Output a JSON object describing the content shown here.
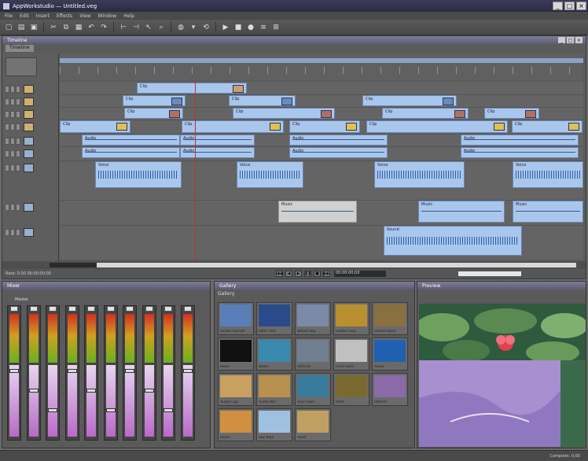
{
  "app": {
    "title": "AppWorkstudio — Untitled.veg",
    "window_controls": [
      "_",
      "□",
      "×"
    ]
  },
  "menu": [
    "File",
    "Edit",
    "Insert",
    "Effects",
    "View",
    "Window",
    "Help"
  ],
  "toolbar": {
    "icons": [
      "new-icon",
      "open-icon",
      "save-icon",
      "cut-icon",
      "copy-icon",
      "paste-icon",
      "undo-icon",
      "redo-icon",
      "trim-icon",
      "split-icon",
      "select-icon",
      "zoom-icon",
      "globe-icon",
      "marker-icon",
      "loop-icon",
      "play-icon",
      "stop-icon",
      "record-icon",
      "mixer-icon",
      "grid-icon"
    ]
  },
  "timeline": {
    "title": "Timeline",
    "tab": "Timeline",
    "tracks": [
      {
        "id": 1,
        "type": "video"
      },
      {
        "id": 2,
        "type": "video"
      },
      {
        "id": 3,
        "type": "video"
      },
      {
        "id": 4,
        "type": "video"
      },
      {
        "id": 5,
        "type": "audio"
      },
      {
        "id": 6,
        "type": "audio"
      },
      {
        "id": 7,
        "type": "audio"
      },
      {
        "id": 8,
        "type": "audio"
      },
      {
        "id": 9,
        "type": "audio"
      }
    ],
    "clips": [
      {
        "track": 0,
        "label": "Clip",
        "kind": "video"
      },
      {
        "track": 1,
        "label": "Clip",
        "kind": "video"
      },
      {
        "track": 2,
        "label": "Clip",
        "kind": "video"
      },
      {
        "track": 3,
        "label": "Clip",
        "kind": "video"
      },
      {
        "track": 4,
        "label": "Audio",
        "kind": "env"
      },
      {
        "track": 5,
        "label": "Audio",
        "kind": "env"
      },
      {
        "track": 6,
        "label": "Voice",
        "kind": "audio"
      },
      {
        "track": 7,
        "label": "Music",
        "kind": "env"
      },
      {
        "track": 8,
        "label": "Sound",
        "kind": "audio"
      }
    ],
    "status": "Rate: 0.00  00:00:00;00",
    "timecode": "00:00:00;00"
  },
  "mixer": {
    "title": "Mixer",
    "channels": 10,
    "master_label": "Master"
  },
  "gallery": {
    "title": "Gallery",
    "tab": "Gallery",
    "items": [
      {
        "name": "Ocean Sunset",
        "color": "#5a7fb8"
      },
      {
        "name": "Palm Tree",
        "color": "#2a4a8a"
      },
      {
        "name": "Beach Sky",
        "color": "#7a8aa8"
      },
      {
        "name": "Golden Sun",
        "color": "#b89030"
      },
      {
        "name": "Desert Rock",
        "color": "#8a7040"
      },
      {
        "name": "Moon",
        "color": "#111111"
      },
      {
        "name": "Water",
        "color": "#3a8ab0"
      },
      {
        "name": "Portrait",
        "color": "#708090"
      },
      {
        "name": "Color Bars",
        "color": "#c0c0c0"
      },
      {
        "name": "Audio",
        "color": "#2060b0"
      },
      {
        "name": "Audio Clip",
        "color": "#c8a060"
      },
      {
        "name": "Audio Mix",
        "color": "#b89050"
      },
      {
        "name": "Sea Foam",
        "color": "#3a7a9a"
      },
      {
        "name": "Shell",
        "color": "#7a6a30"
      },
      {
        "name": "Pattern",
        "color": "#8a6aa8"
      },
      {
        "name": "Dune",
        "color": "#d09040"
      },
      {
        "name": "Sky Blue",
        "color": "#a0c0e0"
      },
      {
        "name": "Sand",
        "color": "#c0a060"
      }
    ]
  },
  "preview": {
    "title": "Preview"
  },
  "statusbar": {
    "text": "Complete: 0.00"
  }
}
